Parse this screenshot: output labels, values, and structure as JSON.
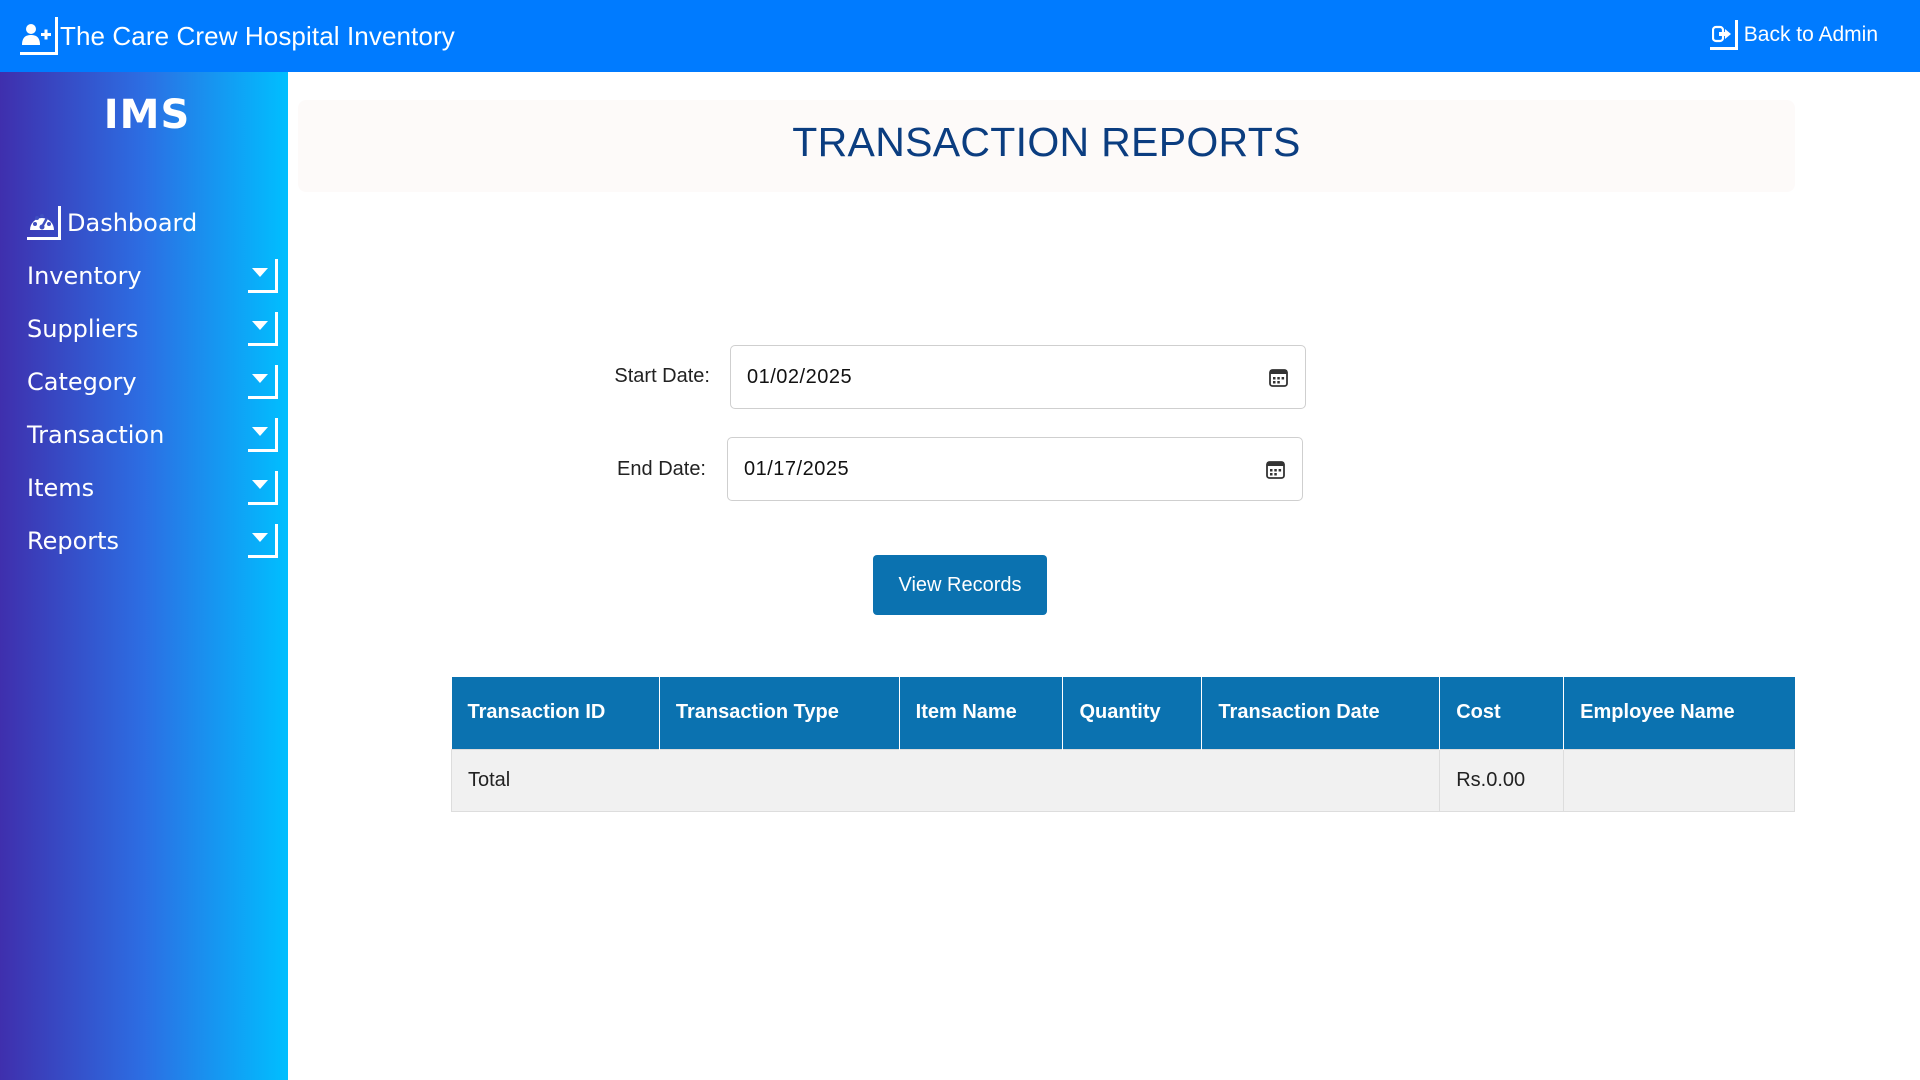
{
  "app": {
    "title": "The Care Crew Hospital Inventory"
  },
  "topbar": {
    "back_label": "Back to Admin",
    "back_icon": "sign-out-icon",
    "brand_icon": "user-plus-icon"
  },
  "sidebar": {
    "logo": "IMS",
    "items": [
      {
        "label": "Dashboard",
        "icon": "tachometer-icon"
      },
      {
        "label": "Inventory",
        "icon": "caret-down-icon"
      },
      {
        "label": "Suppliers",
        "icon": "caret-down-icon"
      },
      {
        "label": "Category",
        "icon": "caret-down-icon"
      },
      {
        "label": "Transaction",
        "icon": "caret-down-icon"
      },
      {
        "label": "Items",
        "icon": "caret-down-icon"
      },
      {
        "label": "Reports",
        "icon": "caret-down-icon"
      }
    ]
  },
  "page": {
    "title": "TRANSACTION REPORTS"
  },
  "form": {
    "start_label": "Start Date:",
    "start_value": "01/02/2025",
    "end_label": "End Date:",
    "end_value": "01/17/2025",
    "submit_label": "View Records"
  },
  "table": {
    "columns": [
      "Transaction ID",
      "Transaction Type",
      "Item Name",
      "Quantity",
      "Transaction Date",
      "Cost",
      "Employee Name"
    ],
    "total_label": "Total",
    "total_cost": "Rs.0.00"
  },
  "colors": {
    "topbar": "#007bff",
    "accent": "#0b72b0",
    "title": "#0b3d80",
    "sidebar_gradient": [
      "#3f2fad",
      "#00bfff"
    ]
  }
}
